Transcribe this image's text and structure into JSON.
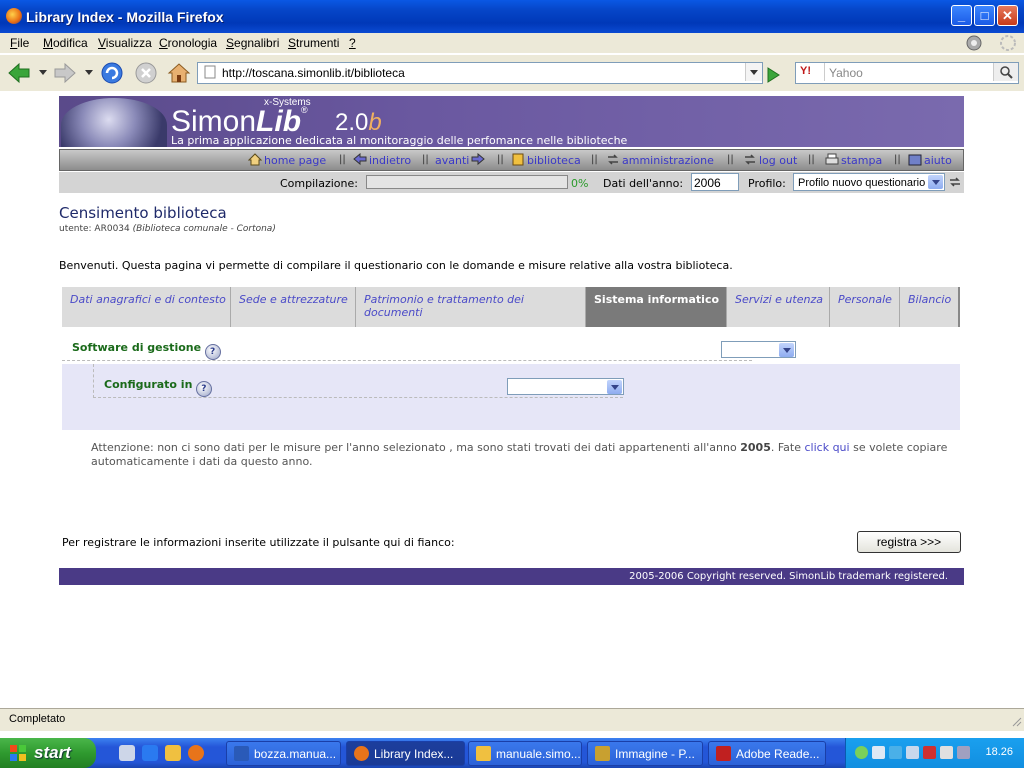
{
  "window": {
    "title": "Library Index - Mozilla Firefox"
  },
  "menu": [
    "File",
    "Modifica",
    "Visualizza",
    "Cronologia",
    "Segnalibri",
    "Strumenti",
    "?"
  ],
  "nav": {
    "url": "http://toscana.simonlib.it/biblioteca",
    "search_placeholder": "Yahoo"
  },
  "banner": {
    "tag": "x-Systems",
    "logo_plain": "Simon",
    "logo_italic": "Lib",
    "version": "2.0",
    "version_suffix": "b",
    "subtitle": "La prima applicazione dedicata al monitoraggio delle perfomance nelle biblioteche"
  },
  "toplinks": [
    "home page",
    "indietro",
    "avanti",
    "biblioteca",
    "amministrazione",
    "log out",
    "stampa",
    "aiuto"
  ],
  "compilation": {
    "label": "Compilazione:",
    "progress_pct": "0%",
    "progress_value": 0,
    "year_label": "Dati dell'anno:",
    "year": "2006",
    "profile_label": "Profilo:",
    "profile_value": "Profilo nuovo questionario"
  },
  "page": {
    "title": "Censimento biblioteca",
    "user_prefix": "utente: AR0034",
    "user_library": "(Biblioteca comunale - Cortona)",
    "welcome": "Benvenuti. Questa pagina vi permette di compilare il questionario con le domande e misure relative alla vostra biblioteca."
  },
  "tabs": [
    {
      "label": "Dati anagrafici e di contesto",
      "active": false
    },
    {
      "label": "Sede e attrezzature",
      "active": false
    },
    {
      "label": "Patrimonio e trattamento dei documenti",
      "active": false
    },
    {
      "label": "Sistema informatico",
      "active": true
    },
    {
      "label": "Servizi e utenza",
      "active": false
    },
    {
      "label": "Personale",
      "active": false
    },
    {
      "label": "Bilancio",
      "active": false
    }
  ],
  "questions": {
    "software": "Software di gestione",
    "configurato": "Configurato in"
  },
  "warning": {
    "part1": "Attenzione: non ci sono dati per le misure per l'anno selezionato , ma sono stati trovati dei dati appartenenti all'anno",
    "year": "2005",
    "part2": ". Fate",
    "link": "click qui",
    "part3": "se volete copiare automaticamente i dati da questo anno."
  },
  "register": {
    "text": "Per registrare le informazioni inserite utilizzate il pulsante qui di fianco:",
    "button": "registra >>>"
  },
  "footer": "2005-2006 Copyright reserved. SimonLib trademark registered.",
  "status": "Completato",
  "taskbar": {
    "start": "start",
    "tasks": [
      {
        "label": "bozza.manua...",
        "active": false,
        "color": "#2a5ab8"
      },
      {
        "label": "Library Index...",
        "active": true,
        "color": "#e8741a"
      },
      {
        "label": "manuale.simo...",
        "active": false,
        "color": "#f0c040"
      },
      {
        "label": "Immagine - P...",
        "active": false,
        "color": "#c8a030"
      },
      {
        "label": "Adobe Reade...",
        "active": false,
        "color": "#c02020"
      }
    ],
    "clock": "18.26"
  }
}
